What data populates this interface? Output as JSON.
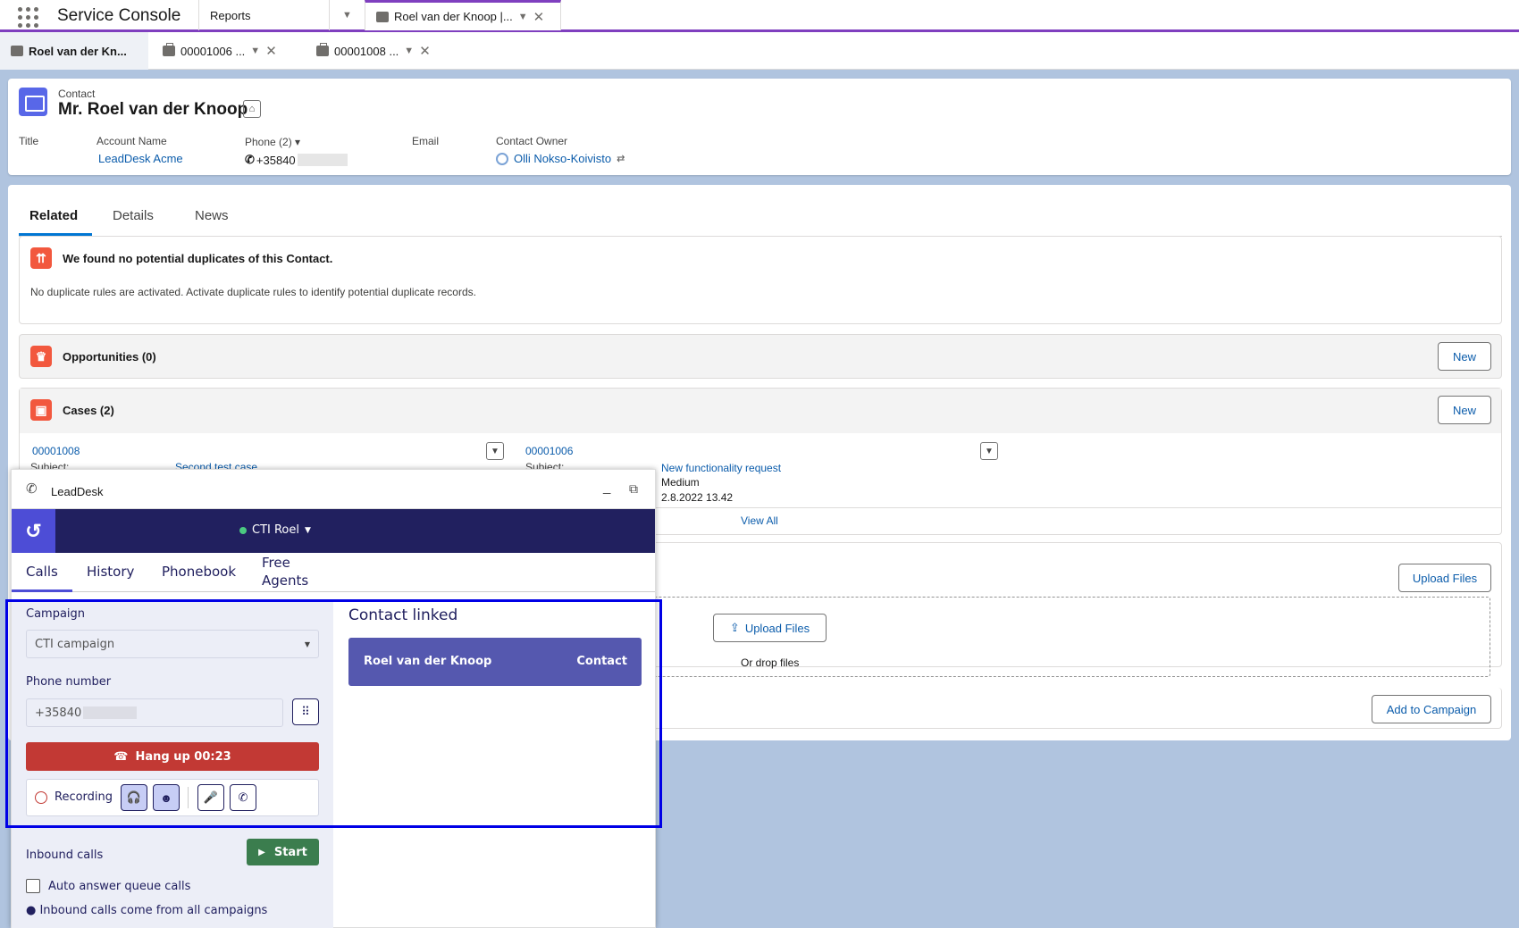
{
  "nav": {
    "app_name": "Service Console",
    "tabs": [
      {
        "label": "Reports"
      },
      {
        "label": "Roel van der Knoop |..."
      }
    ]
  },
  "subtabs": [
    {
      "label": "Roel van der Kn..."
    },
    {
      "label": "00001006 ..."
    },
    {
      "label": "00001008 ..."
    }
  ],
  "header": {
    "object_type": "Contact",
    "name": "Mr. Roel van der Knoop",
    "fields": {
      "title_label": "Title",
      "account_label": "Account Name",
      "account_value": "LeadDesk Acme",
      "phone_label": "Phone (2)",
      "phone_value": "+35840",
      "email_label": "Email",
      "owner_label": "Contact Owner",
      "owner_value": "Olli Nokso-Koivisto"
    }
  },
  "tabs": [
    {
      "label": "Related"
    },
    {
      "label": "Details"
    },
    {
      "label": "News"
    }
  ],
  "duplicates": {
    "title": "We found no potential duplicates of this Contact.",
    "message": "No duplicate rules are activated. Activate duplicate rules to identify potential duplicate records."
  },
  "opportunities": {
    "title": "Opportunities (0)",
    "new_label": "New"
  },
  "cases": {
    "title": "Cases (2)",
    "new_label": "New",
    "items": [
      {
        "number": "00001008",
        "subject_label": "Subject:",
        "subject": "Second test case"
      },
      {
        "number": "00001006",
        "subject_label": "Subject:",
        "subject": "New functionality request",
        "priority": "Medium",
        "date": "2.8.2022 13.42"
      }
    ],
    "view_all": "View All"
  },
  "files": {
    "upload_label": "Upload Files",
    "upload_inner": "Upload Files",
    "drop": "Or drop files"
  },
  "campaign_history": {
    "add_label": "Add to Campaign"
  },
  "cti": {
    "title": "LeadDesk",
    "agent": "CTI Roel",
    "tabs": [
      {
        "label": "Calls"
      },
      {
        "label": "History"
      },
      {
        "label": "Phonebook"
      },
      {
        "label": "Free Agents"
      }
    ],
    "campaign_label": "Campaign",
    "campaign_value": "CTI campaign",
    "phone_label": "Phone number",
    "phone_value": "+35840",
    "hangup_label": "Hang up 00:23",
    "recording_label": "Recording",
    "contact_linked": "Contact linked",
    "linked_name": "Roel van der Knoop",
    "linked_type": "Contact",
    "inbound_label": "Inbound calls",
    "start_label": "Start",
    "auto_answer_label": "Auto answer queue calls",
    "inbound_note": "● Inbound calls come from all campaigns"
  },
  "colors": {
    "accent": "#7f3fbf",
    "cti_dark": "#21205f",
    "hangup": "#c23934",
    "start": "#3b7d4e",
    "linked": "#5558af"
  }
}
